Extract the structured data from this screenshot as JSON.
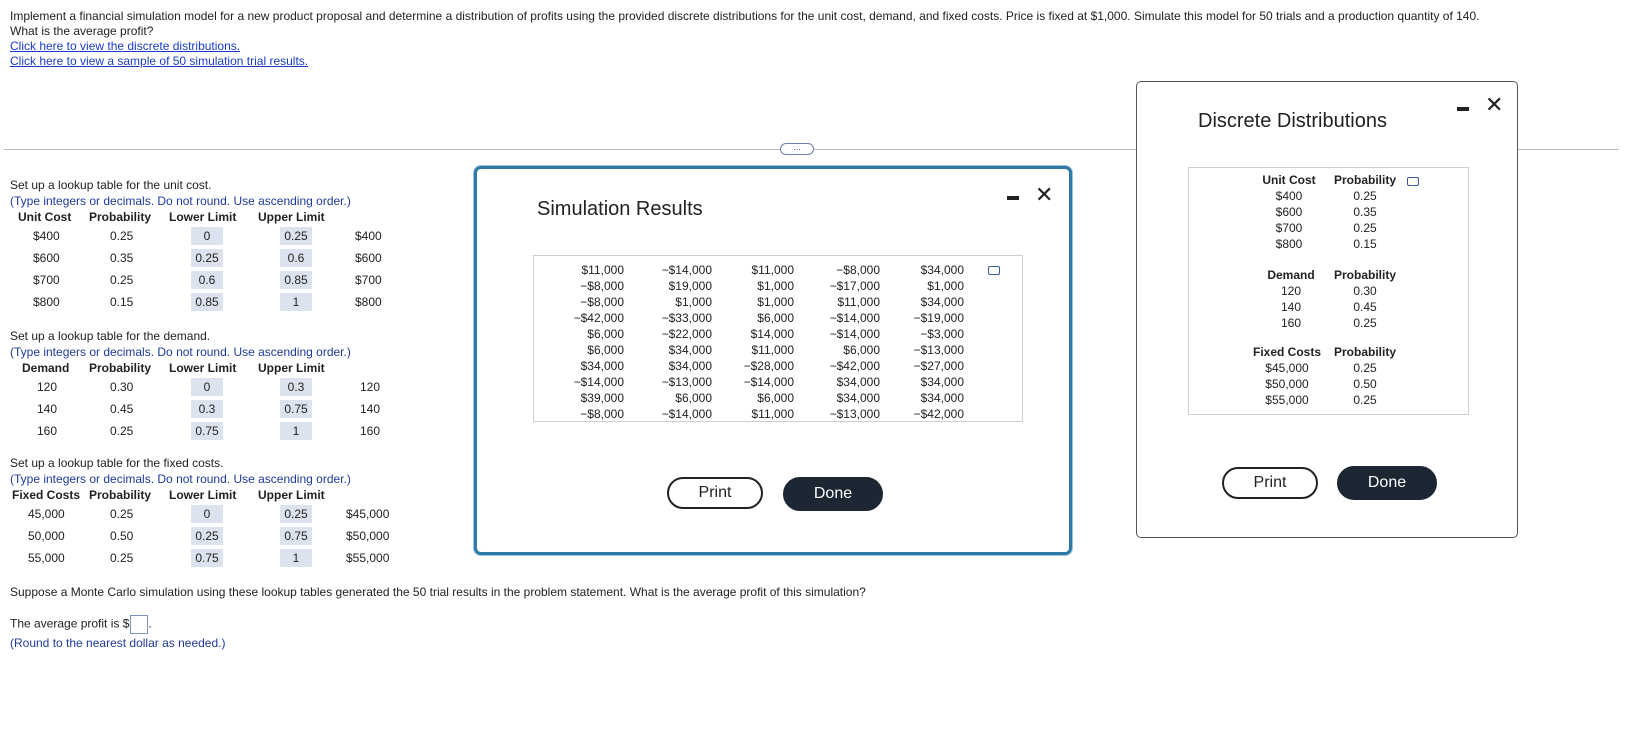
{
  "problem": {
    "line1": "Implement a financial simulation model for a new product proposal and determine a distribution of profits using the provided discrete distributions for the unit cost, demand, and fixed costs. Price is fixed at $1,000. Simulate this model for 50 trials and a production quantity of 140.",
    "line2": "What is the average profit?",
    "link1": "Click here to view the discrete distributions.",
    "link2": "Click here to view a sample of 50 simulation trial results."
  },
  "more_button": "...",
  "unit_cost": {
    "title": "Set up a lookup table for the unit cost.",
    "hint": "(Type integers or decimals. Do not round. Use ascending order.)",
    "headers": [
      "Unit Cost",
      "Probability",
      "Lower Limit",
      "Upper Limit"
    ],
    "rows": [
      {
        "value": "$400",
        "prob": "0.25",
        "lower": "0",
        "upper": "0.25",
        "result": "$400"
      },
      {
        "value": "$600",
        "prob": "0.35",
        "lower": "0.25",
        "upper": "0.6",
        "result": "$600"
      },
      {
        "value": "$700",
        "prob": "0.25",
        "lower": "0.6",
        "upper": "0.85",
        "result": "$700"
      },
      {
        "value": "$800",
        "prob": "0.15",
        "lower": "0.85",
        "upper": "1",
        "result": "$800"
      }
    ]
  },
  "demand": {
    "title": "Set up a lookup table for the demand.",
    "hint": "(Type integers or decimals. Do not round. Use ascending order.)",
    "headers": [
      "Demand",
      "Probability",
      "Lower Limit",
      "Upper Limit"
    ],
    "rows": [
      {
        "value": "120",
        "prob": "0.30",
        "lower": "0",
        "upper": "0.3",
        "result": "120"
      },
      {
        "value": "140",
        "prob": "0.45",
        "lower": "0.3",
        "upper": "0.75",
        "result": "140"
      },
      {
        "value": "160",
        "prob": "0.25",
        "lower": "0.75",
        "upper": "1",
        "result": "160"
      }
    ]
  },
  "fixed": {
    "title": "Set up a lookup table for the fixed costs.",
    "hint": "(Type integers or decimals. Do not round. Use ascending order.)",
    "headers": [
      "Fixed Costs",
      "Probability",
      "Lower Limit",
      "Upper Limit"
    ],
    "rows": [
      {
        "value": "45,000",
        "prob": "0.25",
        "lower": "0",
        "upper": "0.25",
        "result": "$45,000"
      },
      {
        "value": "50,000",
        "prob": "0.50",
        "lower": "0.25",
        "upper": "0.75",
        "result": "$50,000"
      },
      {
        "value": "55,000",
        "prob": "0.25",
        "lower": "0.75",
        "upper": "1",
        "result": "$55,000"
      }
    ]
  },
  "question": "Suppose a Monte Carlo simulation using these lookup tables generated the 50 trial results in the problem statement. What is the average profit of this simulation?",
  "answer": {
    "prefix": "The average profit is $",
    "suffix": ".",
    "note": "(Round to the nearest dollar as needed.)"
  },
  "sim_modal": {
    "title": "Simulation Results",
    "print": "Print",
    "done": "Done",
    "columns": [
      [
        "$11,000",
        "−$8,000",
        "−$8,000",
        "−$42,000",
        "$6,000",
        "$6,000",
        "$34,000",
        "−$14,000",
        "$39,000",
        "−$8,000"
      ],
      [
        "−$14,000",
        "$19,000",
        "$1,000",
        "−$33,000",
        "−$22,000",
        "$34,000",
        "$34,000",
        "−$13,000",
        "$6,000",
        "−$14,000"
      ],
      [
        "$11,000",
        "$1,000",
        "$1,000",
        "$6,000",
        "$14,000",
        "$11,000",
        "−$28,000",
        "−$14,000",
        "$6,000",
        "$11,000"
      ],
      [
        "−$8,000",
        "−$17,000",
        "$11,000",
        "−$14,000",
        "−$14,000",
        "$6,000",
        "−$42,000",
        "$34,000",
        "$34,000",
        "−$13,000"
      ],
      [
        "$34,000",
        "$1,000",
        "$34,000",
        "−$19,000",
        "−$3,000",
        "−$13,000",
        "−$27,000",
        "$34,000",
        "$34,000",
        "−$42,000"
      ]
    ]
  },
  "dist_modal": {
    "title": "Discrete Distributions",
    "print": "Print",
    "done": "Done",
    "unit_cost": {
      "header": [
        "Unit Cost",
        "Probability"
      ],
      "values": [
        "$400",
        "$600",
        "$700",
        "$800"
      ],
      "probs": [
        "0.25",
        "0.35",
        "0.25",
        "0.15"
      ]
    },
    "demand": {
      "header": [
        "Demand",
        "Probability"
      ],
      "values": [
        "120",
        "140",
        "160"
      ],
      "probs": [
        "0.30",
        "0.45",
        "0.25"
      ]
    },
    "fixed": {
      "header": [
        "Fixed Costs",
        "Probability"
      ],
      "values": [
        "$45,000",
        "$50,000",
        "$55,000"
      ],
      "probs": [
        "0.25",
        "0.50",
        "0.25"
      ]
    }
  },
  "icons": {
    "minimize": "minimize-icon",
    "close": "close-icon",
    "copy": "copy-icon"
  }
}
